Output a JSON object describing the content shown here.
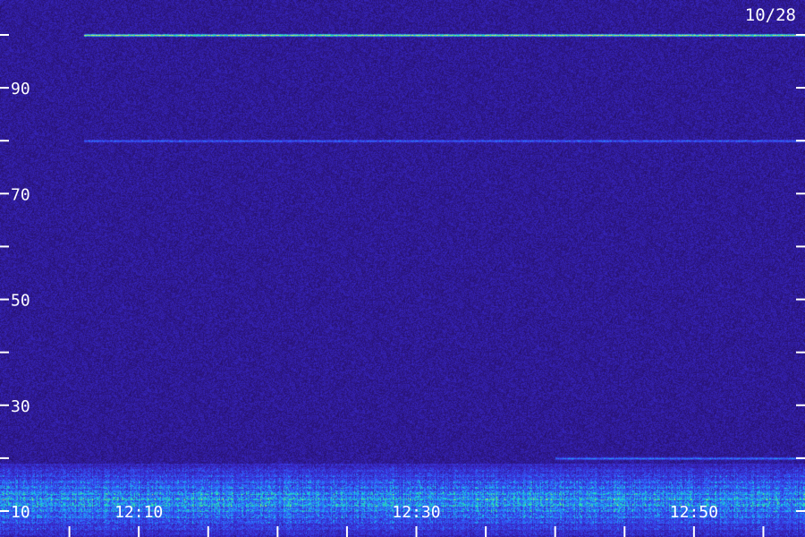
{
  "date_label": "10/28",
  "chart_data": {
    "type": "heatmap",
    "title": "",
    "xlabel": "",
    "ylabel": "",
    "x_tick_labels": [
      "12:10",
      "12:30",
      "12:50"
    ],
    "y_tick_labels": [
      "10",
      "30",
      "50",
      "70",
      "90"
    ],
    "ylim": [
      10,
      100
    ],
    "xlim": [
      "12:00",
      "12:58"
    ],
    "y_ticks_every": 10,
    "x_ticks_every_minutes": 5,
    "colormap": [
      "#1a0840",
      "#2b1580",
      "#3a2ad0",
      "#2f66ff",
      "#18c8e8",
      "#3cf080",
      "#e8f040"
    ],
    "features": [
      {
        "kind": "narrow_band",
        "y": 100,
        "intensity": 0.85,
        "x_start": "12:06",
        "x_end": "12:58"
      },
      {
        "kind": "narrow_band",
        "y": 80,
        "intensity": 0.35,
        "x_start": "12:06",
        "x_end": "12:58"
      },
      {
        "kind": "narrow_band",
        "y": 20,
        "intensity": 0.4,
        "x_start": "12:40",
        "x_end": "12:58"
      },
      {
        "kind": "broad_band",
        "y_range": [
          10,
          19
        ],
        "intensity": 0.7,
        "peak_y": 12
      }
    ],
    "grid": false,
    "legend": "none"
  }
}
